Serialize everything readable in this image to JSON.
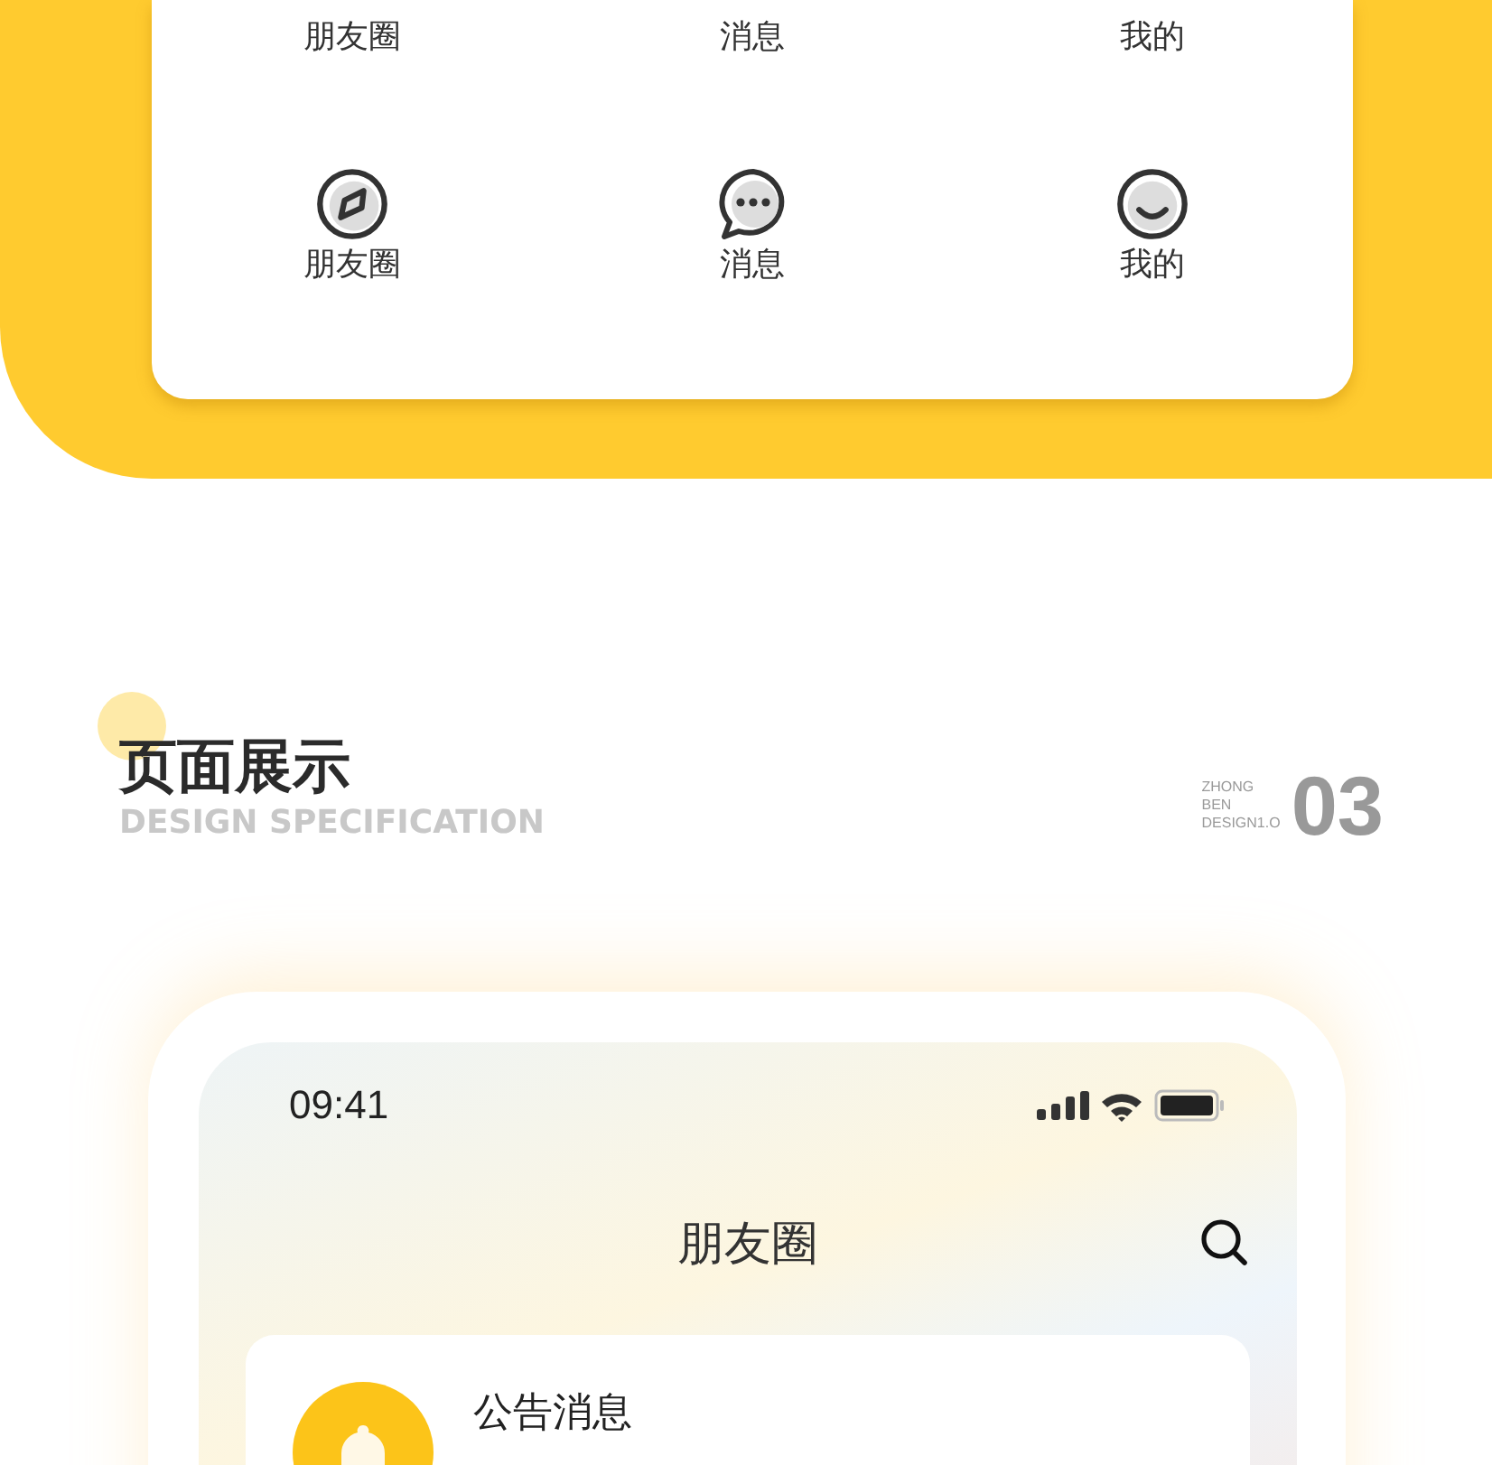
{
  "tab_bar_preview": {
    "rows": [
      {
        "kind": "labels",
        "items": [
          {
            "label": "朋友圈"
          },
          {
            "label": "消息"
          },
          {
            "label": "我的"
          }
        ]
      },
      {
        "kind": "icons",
        "items": [
          {
            "label": "朋友圈"
          },
          {
            "label": "消息"
          },
          {
            "label": "我的"
          }
        ]
      }
    ]
  },
  "section": {
    "title": "页面展示",
    "subtitle": "DESIGN SPECIFICATION",
    "brand_lines": [
      "ZHONG",
      "BEN",
      "DESIGN1.O"
    ],
    "number": "03"
  },
  "phone": {
    "time": "09:41",
    "title": "朋友圈",
    "notice": {
      "title": "公告消息"
    }
  }
}
